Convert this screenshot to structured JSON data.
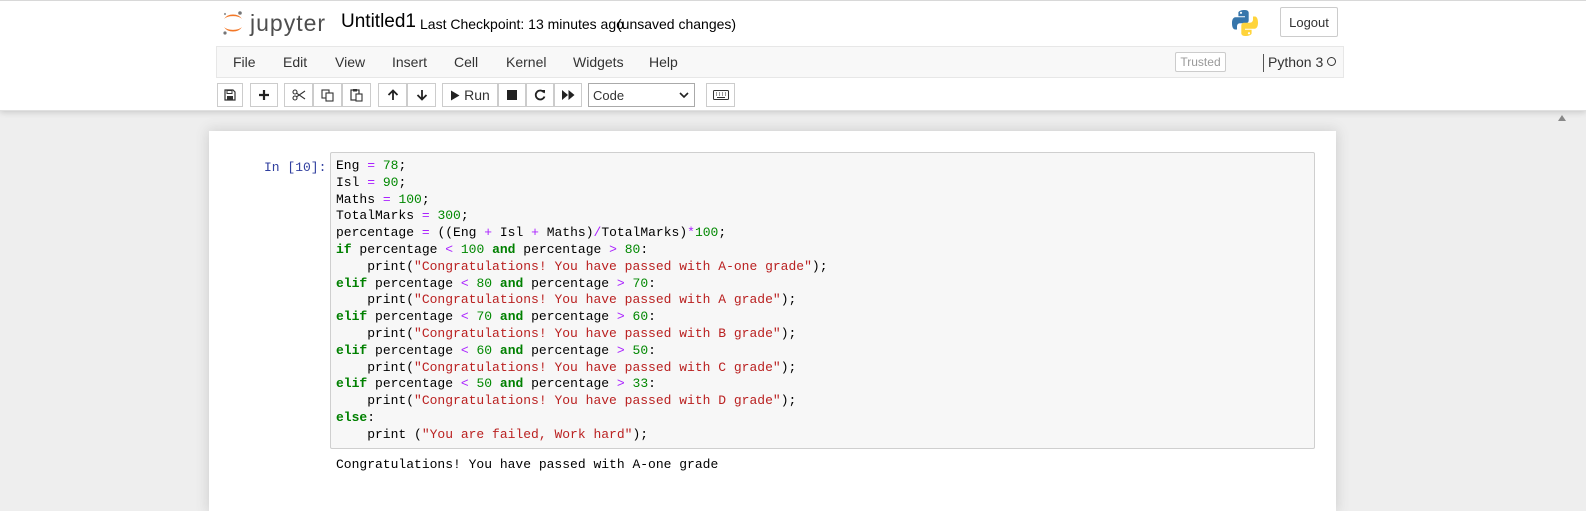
{
  "header": {
    "logo_text": "jupyter",
    "notebook_name": "Untitled1",
    "checkpoint": "Last Checkpoint: 13 minutes ago",
    "autosave": "(unsaved changes)",
    "logout_label": "Logout"
  },
  "menubar": {
    "items": [
      "File",
      "Edit",
      "View",
      "Insert",
      "Cell",
      "Kernel",
      "Widgets",
      "Help"
    ],
    "trusted_label": "Trusted",
    "kernel_name": "Python 3"
  },
  "toolbar": {
    "buttons": [
      {
        "name": "save-button",
        "icon": "floppy-disk-icon"
      },
      {
        "name": "insert-cell-button",
        "icon": "plus-icon"
      },
      {
        "name": "cut-button",
        "icon": "scissors-icon"
      },
      {
        "name": "copy-button",
        "icon": "copy-icon"
      },
      {
        "name": "paste-button",
        "icon": "paste-icon"
      },
      {
        "name": "move-up-button",
        "icon": "arrow-up-icon"
      },
      {
        "name": "move-down-button",
        "icon": "arrow-down-icon"
      },
      {
        "name": "run-button",
        "icon": "play-icon"
      },
      {
        "name": "interrupt-button",
        "icon": "stop-icon"
      },
      {
        "name": "restart-button",
        "icon": "restart-icon"
      },
      {
        "name": "restart-run-all-button",
        "icon": "fast-forward-icon"
      },
      {
        "name": "command-palette-button",
        "icon": "keyboard-icon"
      }
    ],
    "run_label": "Run",
    "cell_type": "Code"
  },
  "cell": {
    "prompt": "In [10]:",
    "code_lines": [
      [
        [
          "plain",
          "Eng "
        ],
        [
          "op",
          "="
        ],
        [
          "plain",
          " "
        ],
        [
          "num",
          "78"
        ],
        [
          "plain",
          ";"
        ]
      ],
      [
        [
          "plain",
          "Isl "
        ],
        [
          "op",
          "="
        ],
        [
          "plain",
          " "
        ],
        [
          "num",
          "90"
        ],
        [
          "plain",
          ";"
        ]
      ],
      [
        [
          "plain",
          "Maths "
        ],
        [
          "op",
          "="
        ],
        [
          "plain",
          " "
        ],
        [
          "num",
          "100"
        ],
        [
          "plain",
          ";"
        ]
      ],
      [
        [
          "plain",
          "TotalMarks "
        ],
        [
          "op",
          "="
        ],
        [
          "plain",
          " "
        ],
        [
          "num",
          "300"
        ],
        [
          "plain",
          ";"
        ]
      ],
      [
        [
          "plain",
          "percentage "
        ],
        [
          "op",
          "="
        ],
        [
          "plain",
          " ((Eng "
        ],
        [
          "op",
          "+"
        ],
        [
          "plain",
          " Isl "
        ],
        [
          "op",
          "+"
        ],
        [
          "plain",
          " Maths)"
        ],
        [
          "op",
          "/"
        ],
        [
          "plain",
          "TotalMarks)"
        ],
        [
          "op",
          "*"
        ],
        [
          "num",
          "100"
        ],
        [
          "plain",
          ";"
        ]
      ],
      [
        [
          "kw",
          "if"
        ],
        [
          "plain",
          " percentage "
        ],
        [
          "op",
          "<"
        ],
        [
          "plain",
          " "
        ],
        [
          "num",
          "100"
        ],
        [
          "plain",
          " "
        ],
        [
          "kw",
          "and"
        ],
        [
          "plain",
          " percentage "
        ],
        [
          "op",
          ">"
        ],
        [
          "plain",
          " "
        ],
        [
          "num",
          "80"
        ],
        [
          "plain",
          ":"
        ]
      ],
      [
        [
          "plain",
          "    print("
        ],
        [
          "str",
          "\"Congratulations! You have passed with A-one grade\""
        ],
        [
          "plain",
          ");"
        ]
      ],
      [
        [
          "kw",
          "elif"
        ],
        [
          "plain",
          " percentage "
        ],
        [
          "op",
          "<"
        ],
        [
          "plain",
          " "
        ],
        [
          "num",
          "80"
        ],
        [
          "plain",
          " "
        ],
        [
          "kw",
          "and"
        ],
        [
          "plain",
          " percentage "
        ],
        [
          "op",
          ">"
        ],
        [
          "plain",
          " "
        ],
        [
          "num",
          "70"
        ],
        [
          "plain",
          ":"
        ]
      ],
      [
        [
          "plain",
          "    print("
        ],
        [
          "str",
          "\"Congratulations! You have passed with A grade\""
        ],
        [
          "plain",
          ");"
        ]
      ],
      [
        [
          "kw",
          "elif"
        ],
        [
          "plain",
          " percentage "
        ],
        [
          "op",
          "<"
        ],
        [
          "plain",
          " "
        ],
        [
          "num",
          "70"
        ],
        [
          "plain",
          " "
        ],
        [
          "kw",
          "and"
        ],
        [
          "plain",
          " percentage "
        ],
        [
          "op",
          ">"
        ],
        [
          "plain",
          " "
        ],
        [
          "num",
          "60"
        ],
        [
          "plain",
          ":"
        ]
      ],
      [
        [
          "plain",
          "    print("
        ],
        [
          "str",
          "\"Congratulations! You have passed with B grade\""
        ],
        [
          "plain",
          ");"
        ]
      ],
      [
        [
          "kw",
          "elif"
        ],
        [
          "plain",
          " percentage "
        ],
        [
          "op",
          "<"
        ],
        [
          "plain",
          " "
        ],
        [
          "num",
          "60"
        ],
        [
          "plain",
          " "
        ],
        [
          "kw",
          "and"
        ],
        [
          "plain",
          " percentage "
        ],
        [
          "op",
          ">"
        ],
        [
          "plain",
          " "
        ],
        [
          "num",
          "50"
        ],
        [
          "plain",
          ":"
        ]
      ],
      [
        [
          "plain",
          "    print("
        ],
        [
          "str",
          "\"Congratulations! You have passed with C grade\""
        ],
        [
          "plain",
          ");"
        ]
      ],
      [
        [
          "kw",
          "elif"
        ],
        [
          "plain",
          " percentage "
        ],
        [
          "op",
          "<"
        ],
        [
          "plain",
          " "
        ],
        [
          "num",
          "50"
        ],
        [
          "plain",
          " "
        ],
        [
          "kw",
          "and"
        ],
        [
          "plain",
          " percentage "
        ],
        [
          "op",
          ">"
        ],
        [
          "plain",
          " "
        ],
        [
          "num",
          "33"
        ],
        [
          "plain",
          ":"
        ]
      ],
      [
        [
          "plain",
          "    print("
        ],
        [
          "str",
          "\"Congratulations! You have passed with D grade\""
        ],
        [
          "plain",
          ");"
        ]
      ],
      [
        [
          "kw",
          "else"
        ],
        [
          "plain",
          ":"
        ]
      ],
      [
        [
          "plain",
          "    print ("
        ],
        [
          "str",
          "\"You are failed, Work hard\""
        ],
        [
          "plain",
          ");"
        ]
      ]
    ],
    "output": "Congratulations! You have passed with A-one grade"
  },
  "colors": {
    "prompt": "#303f9f",
    "keyword": "#008000",
    "number": "#008800",
    "operator": "#aa22ff",
    "string": "#ba2121",
    "logo_orange": "#f37726"
  }
}
